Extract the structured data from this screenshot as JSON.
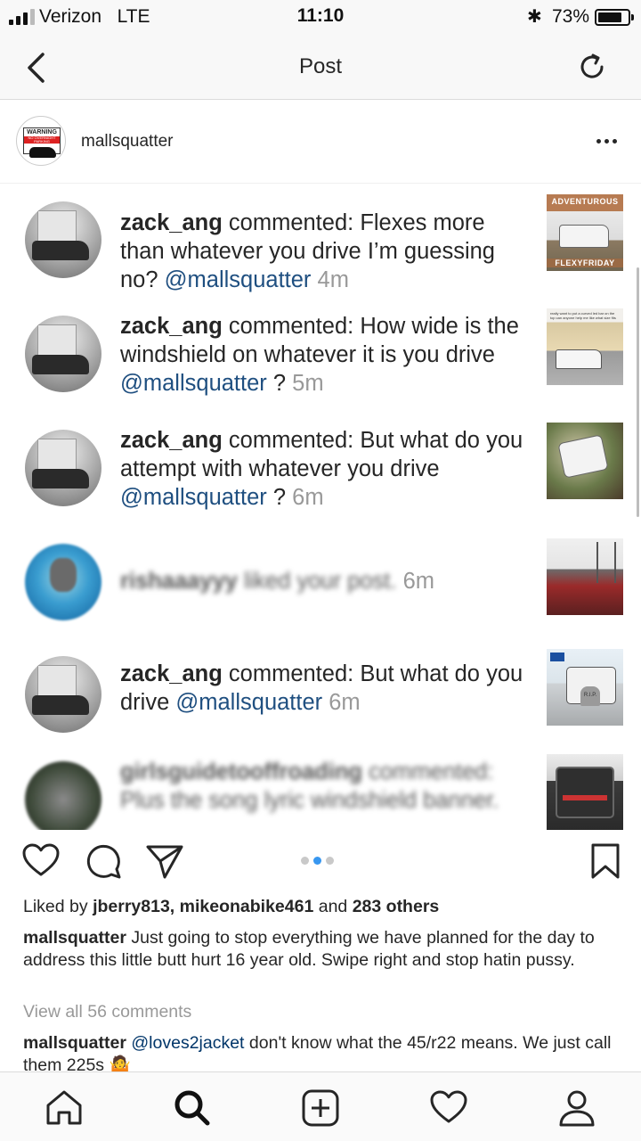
{
  "status_bar": {
    "carrier": "Verizon",
    "network": "LTE",
    "time": "11:10",
    "battery": "73%",
    "signal_bars": 3,
    "signal_total": 4
  },
  "nav": {
    "title": "Post",
    "back_icon": "chevron-left-icon",
    "refresh_icon": "refresh-icon"
  },
  "post": {
    "username": "mallsquatter",
    "avatar_sign": {
      "line1": "WARNING",
      "line2": "NO OVERNIGHT PARKING"
    },
    "more_icon": "more-horizontal-icon"
  },
  "notifications": [
    {
      "user": "zack_ang",
      "verb": "commented:",
      "text": "Flexes more than whatever you drive I’m guessing no?",
      "mention": "@mallsquatter",
      "suffix": "",
      "time": "4m",
      "thumb_top": "ADVENTUROUS",
      "thumb_bottom": "FLEXYFRIDAY"
    },
    {
      "user": "zack_ang",
      "verb": "commented:",
      "text": "How wide is the windshield on whatever it is you drive",
      "mention": "@mallsquatter",
      "suffix": "?",
      "time": "5m",
      "thumb_caption": "really want to put a curved led bar on the top can anyone help me like what size fits on it"
    },
    {
      "user": "zack_ang",
      "verb": "commented:",
      "text": "But what do you attempt with whatever you drive",
      "mention": "@mallsquatter",
      "suffix": "?",
      "time": "6m"
    },
    {
      "user": "rishaaayyy",
      "verb": "liked your post.",
      "time": "6m",
      "blurred": true
    },
    {
      "user": "zack_ang",
      "verb": "commented:",
      "text": "But what do you drive",
      "mention": "@mallsquatter",
      "suffix": "",
      "time": "6m",
      "thumb_stone": "R.I.P."
    },
    {
      "user": "girlsguidetooffroading",
      "verb": "commented:",
      "text": "Plus the song lyric windshield banner.",
      "blurred": true
    }
  ],
  "actions": {
    "like_icon": "heart-icon",
    "comment_icon": "comment-icon",
    "share_icon": "send-icon",
    "save_icon": "bookmark-icon",
    "carousel_count": 3,
    "carousel_active": 2
  },
  "likes": {
    "prefix": "Liked by",
    "users": "jberry813, mikeonabike461",
    "conj": "and",
    "others": "283 others"
  },
  "caption": {
    "user": "mallsquatter",
    "text": "Just going to stop everything we have planned for the day to address this little butt hurt 16 year old. Swipe right and stop hatin pussy."
  },
  "view_all": "View all 56 comments",
  "comment": {
    "user": "mallsquatter",
    "mention": "@loves2jacket",
    "text": "don't know what the 45/r22 means. We just call them 225s 🤷"
  },
  "tabbar": [
    "home-icon",
    "search-icon",
    "add-post-icon",
    "activity-heart-icon",
    "profile-icon"
  ]
}
